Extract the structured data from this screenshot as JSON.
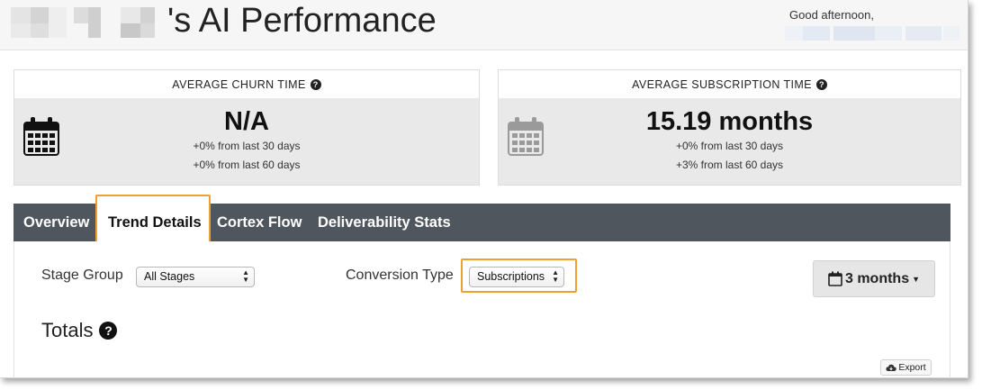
{
  "header": {
    "title": "'s AI Performance",
    "greeting": "Good afternoon,"
  },
  "cards": [
    {
      "heading": "AVERAGE CHURN TIME",
      "value": "N/A",
      "line1": "+0% from last 30 days",
      "line2": "+0% from last 60 days",
      "icon": "calendar-icon"
    },
    {
      "heading": "AVERAGE SUBSCRIPTION TIME",
      "value": "15.19 months",
      "line1": "+0% from last 30 days",
      "line2": "+3% from last 60 days",
      "icon": "calendar-icon"
    }
  ],
  "tabs": [
    {
      "label": "Overview",
      "active": false
    },
    {
      "label": "Trend Details",
      "active": true
    },
    {
      "label": "Cortex Flow",
      "active": false
    },
    {
      "label": "Deliverability Stats",
      "active": false
    }
  ],
  "filters": {
    "stage_group_label": "Stage Group",
    "stage_group_value": "All Stages",
    "conversion_type_label": "Conversion Type",
    "conversion_type_value": "Subscriptions"
  },
  "date_range": {
    "label": "3 months",
    "icon": "calendar-icon"
  },
  "totals": {
    "heading": "Totals"
  },
  "export": {
    "label": "Export",
    "icon": "cloud-download-icon"
  },
  "colors": {
    "tabbar": "#4f565d",
    "highlight": "#f0a030",
    "card_body": "#e9e9e9"
  }
}
